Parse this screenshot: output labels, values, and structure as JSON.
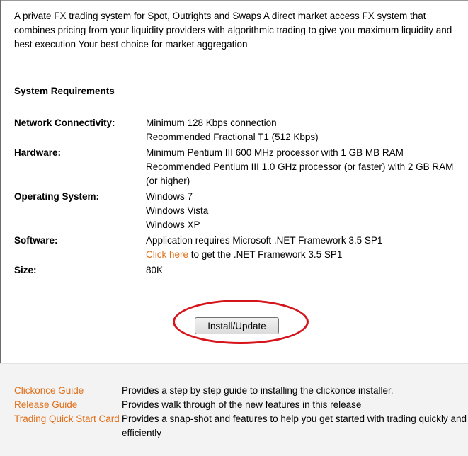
{
  "intro": "A private FX trading system for Spot, Outrights and Swaps A direct market access FX system that combines pricing from your liquidity providers with algorithmic trading to give you maximum liquidity and best execution Your best choice for market aggregation",
  "requirements": {
    "title": "System Requirements",
    "network": {
      "label": "Network Connectivity:",
      "lines": [
        "Minimum 128 Kbps connection",
        "Recommended Fractional T1 (512 Kbps)"
      ]
    },
    "hardware": {
      "label": "Hardware:",
      "lines": [
        "Minimum Pentium III 600 MHz processor with 1 GB MB RAM",
        "Recommended Pentium III 1.0 GHz processor (or faster) with 2 GB RAM (or higher)"
      ]
    },
    "os": {
      "label": "Operating System:",
      "lines": [
        "Windows 7",
        "Windows Vista",
        "Windows XP"
      ]
    },
    "software": {
      "label": "Software:",
      "line1": "Application requires Microsoft .NET Framework 3.5 SP1",
      "link": "Click here",
      "line2_rest": " to get the .NET Framework 3.5 SP1"
    },
    "size": {
      "label": "Size:",
      "value": "80K"
    }
  },
  "install_button": "Install/Update",
  "guides": [
    {
      "link": "Clickonce Guide",
      "desc": "Provides a step by step guide to installing the clickonce installer."
    },
    {
      "link": "Release Guide",
      "desc": "Provides walk through of the new features in this release"
    },
    {
      "link": "Trading Quick Start Card",
      "desc": "Provides a snap-shot and features to help you get started with trading quickly and efficiently"
    }
  ],
  "colors": {
    "link": "#e06f1a",
    "highlight": "#d6141c"
  }
}
